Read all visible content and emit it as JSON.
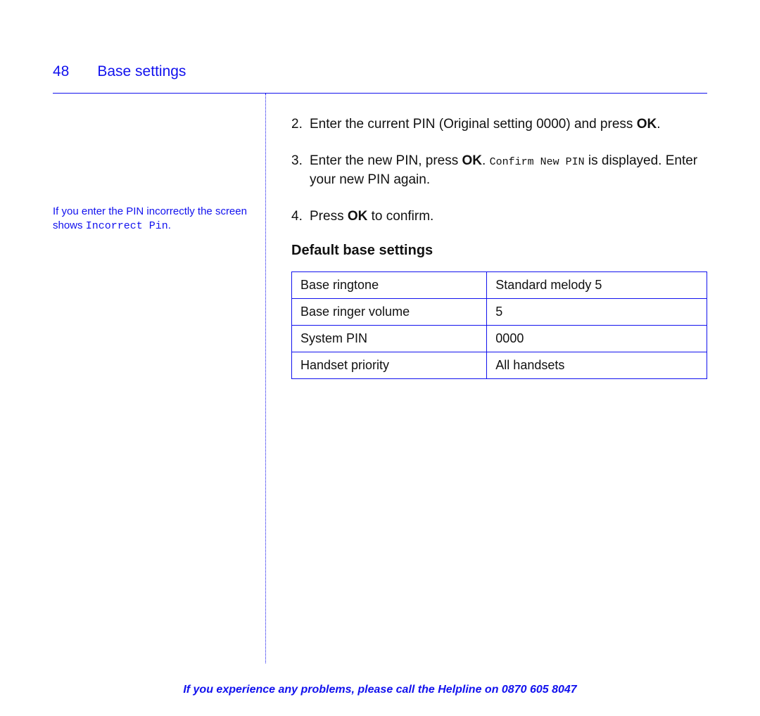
{
  "header": {
    "page_number": "48",
    "title": "Base settings"
  },
  "sidenote": {
    "prefix": "If you enter the PIN incorrectly the screen shows ",
    "mono": "Incorrect Pin",
    "suffix": "."
  },
  "steps": [
    {
      "num": "2.",
      "parts": [
        "Enter the current PIN (Original setting 0000) and press ",
        "OK",
        "."
      ]
    },
    {
      "num": "3.",
      "parts_a": [
        "Enter the new PIN, press ",
        "OK",
        ". "
      ],
      "mono": "Confirm New PIN",
      "parts_b": " is displayed. Enter your new PIN again."
    },
    {
      "num": "4.",
      "parts": [
        "Press ",
        "OK",
        " to confirm."
      ]
    }
  ],
  "subheading": "Default base settings",
  "table": {
    "rows": [
      {
        "label": "Base ringtone",
        "value": "Standard melody 5"
      },
      {
        "label": "Base ringer volume",
        "value": "5"
      },
      {
        "label": "System PIN",
        "value": "0000"
      },
      {
        "label": "Handset priority",
        "value": "All handsets"
      }
    ]
  },
  "footer": {
    "text": "If you experience any problems, please call the Helpline on ",
    "phone": "0870 605 8047"
  }
}
